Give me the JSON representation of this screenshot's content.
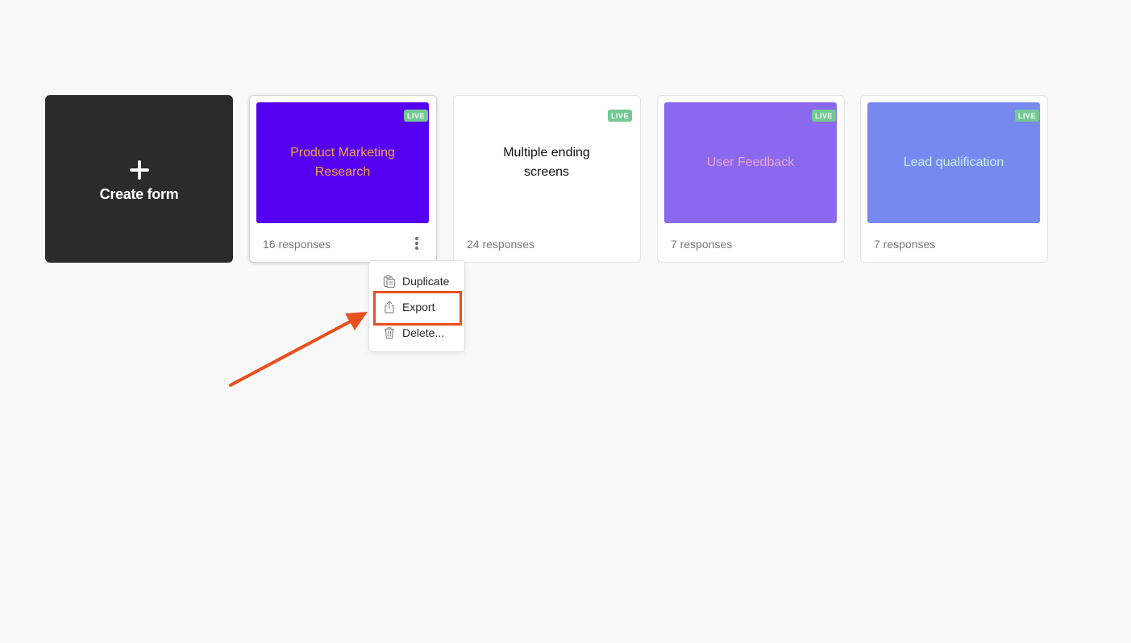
{
  "create": {
    "label": "Create form"
  },
  "forms": [
    {
      "title": "Product Marketing Research",
      "badge": "LIVE",
      "responses": "16 responses",
      "bg_color": "#5500f0",
      "text_color": "#f0a341"
    },
    {
      "title": "Multiple ending screens",
      "badge": "LIVE",
      "responses": "24 responses",
      "bg_color": "#ffffff",
      "text_color": "#111111"
    },
    {
      "title": "User Feedback",
      "badge": "LIVE",
      "responses": "7 responses",
      "bg_color": "#8b69ee",
      "text_color": "#e6a6d8"
    },
    {
      "title": "Lead qualification",
      "badge": "LIVE",
      "responses": "7 responses",
      "bg_color": "#7689f1",
      "text_color": "#c9eef3"
    }
  ],
  "menu": {
    "items": [
      {
        "label": "Duplicate",
        "icon": "duplicate-icon"
      },
      {
        "label": "Export",
        "icon": "export-icon"
      },
      {
        "label": "Delete...",
        "icon": "trash-icon"
      }
    ]
  },
  "annotation": {
    "color": "#e8501f"
  }
}
